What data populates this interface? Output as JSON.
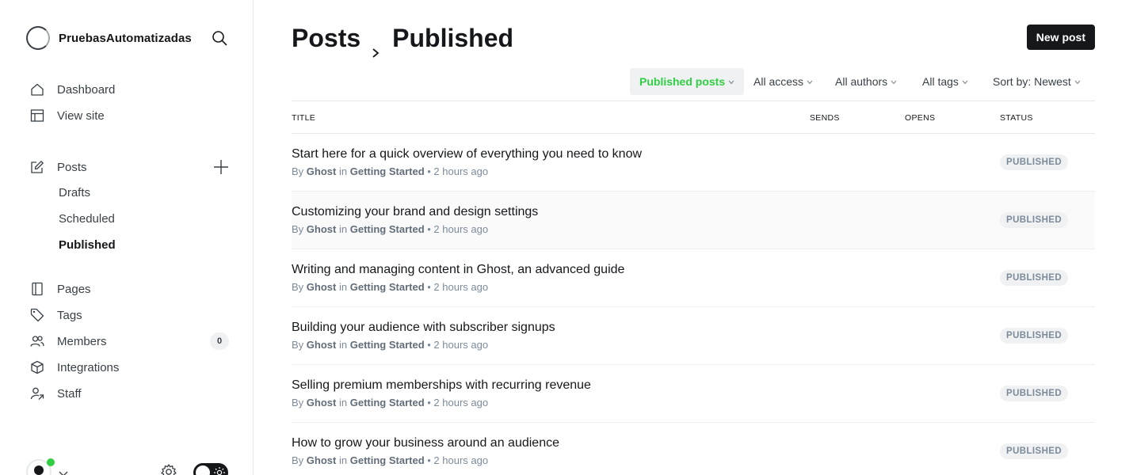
{
  "brand": {
    "name": "PruebasAutomatizadas"
  },
  "nav": {
    "dashboard": "Dashboard",
    "view_site": "View site",
    "posts": "Posts",
    "drafts": "Drafts",
    "scheduled": "Scheduled",
    "published": "Published",
    "pages": "Pages",
    "tags": "Tags",
    "members": "Members",
    "members_count": "0",
    "integrations": "Integrations",
    "staff": "Staff"
  },
  "header": {
    "section": "Posts",
    "current": "Published",
    "new_post": "New post"
  },
  "filters": {
    "type": "Published posts",
    "access": "All access",
    "authors": "All authors",
    "tags": "All tags",
    "sort": "Sort by: Newest"
  },
  "columns": {
    "title": "TITLE",
    "sends": "SENDS",
    "opens": "OPENS",
    "status": "STATUS"
  },
  "posts": [
    {
      "title": "Start here for a quick overview of everything you need to know",
      "by": "By",
      "author": "Ghost",
      "in": "in",
      "tag": "Getting Started",
      "time": "• 2 hours ago",
      "status": "PUBLISHED"
    },
    {
      "title": "Customizing your brand and design settings",
      "by": "By",
      "author": "Ghost",
      "in": "in",
      "tag": "Getting Started",
      "time": "• 2 hours ago",
      "status": "PUBLISHED"
    },
    {
      "title": "Writing and managing content in Ghost, an advanced guide",
      "by": "By",
      "author": "Ghost",
      "in": "in",
      "tag": "Getting Started",
      "time": "• 2 hours ago",
      "status": "PUBLISHED"
    },
    {
      "title": "Building your audience with subscriber signups",
      "by": "By",
      "author": "Ghost",
      "in": "in",
      "tag": "Getting Started",
      "time": "• 2 hours ago",
      "status": "PUBLISHED"
    },
    {
      "title": "Selling premium memberships with recurring revenue",
      "by": "By",
      "author": "Ghost",
      "in": "in",
      "tag": "Getting Started",
      "time": "• 2 hours ago",
      "status": "PUBLISHED"
    },
    {
      "title": "How to grow your business around an audience",
      "by": "By",
      "author": "Ghost",
      "in": "in",
      "tag": "Getting Started",
      "time": "• 2 hours ago",
      "status": "PUBLISHED"
    }
  ],
  "colors": {
    "accent": "#30cf43",
    "text": "#15171a",
    "muted": "#7c8b9a"
  }
}
